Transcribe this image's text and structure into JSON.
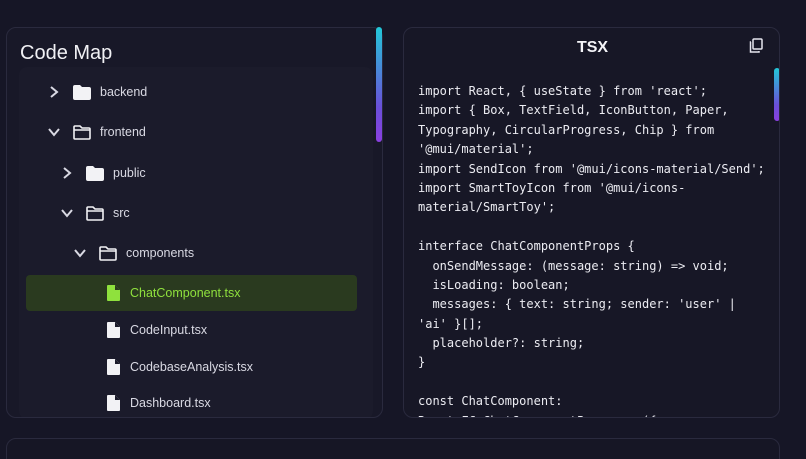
{
  "code_map": {
    "title": "Code Map",
    "items": [
      {
        "label": "backend",
        "kind": "folder",
        "expanded": false
      },
      {
        "label": "frontend",
        "kind": "folder",
        "expanded": true
      },
      {
        "label": "public",
        "kind": "folder",
        "expanded": false
      },
      {
        "label": "src",
        "kind": "folder",
        "expanded": true
      },
      {
        "label": "components",
        "kind": "folder",
        "expanded": true
      },
      {
        "label": "ChatComponent.tsx",
        "kind": "file",
        "selected": true
      },
      {
        "label": "CodeInput.tsx",
        "kind": "file"
      },
      {
        "label": "CodebaseAnalysis.tsx",
        "kind": "file"
      },
      {
        "label": "Dashboard.tsx",
        "kind": "file"
      }
    ]
  },
  "code_view": {
    "title": "TSX",
    "copy_icon": "copy-icon",
    "lines": [
      "import React, { useState } from 'react';",
      "import { Box, TextField, IconButton, Paper,",
      "Typography, CircularProgress, Chip } from",
      "'@mui/material';",
      "import SendIcon from '@mui/icons-material/Send';",
      "import SmartToyIcon from '@mui/icons-",
      "material/SmartToy';",
      "",
      "interface ChatComponentProps {",
      "  onSendMessage: (message: string) => void;",
      "  isLoading: boolean;",
      "  messages: { text: string; sender: 'user' |",
      "'ai' }[];",
      "  placeholder?: string;",
      "}",
      "",
      "const ChatComponent:",
      "React.FC<ChatComponentProps> = ({"
    ]
  },
  "colors": {
    "selected_text": "#8fe13d",
    "selected_bg": "#2a3a1f",
    "background": "#161626"
  }
}
